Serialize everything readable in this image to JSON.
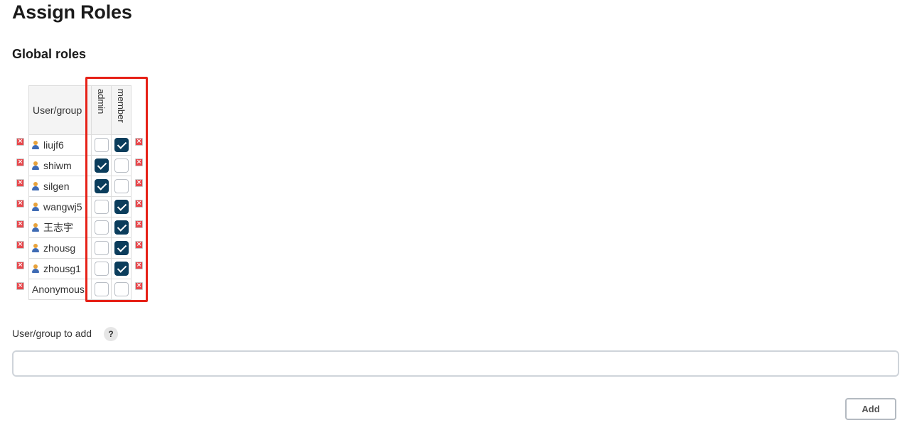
{
  "page": {
    "title": "Assign Roles"
  },
  "section": {
    "title": "Global roles"
  },
  "table": {
    "user_column_header": "User/group",
    "roles": [
      "admin",
      "member"
    ],
    "rows": [
      {
        "name": "liujf6",
        "type": "user",
        "assignments": [
          false,
          true
        ]
      },
      {
        "name": "shiwm",
        "type": "user",
        "assignments": [
          true,
          false
        ]
      },
      {
        "name": "silgen",
        "type": "user",
        "assignments": [
          true,
          false
        ]
      },
      {
        "name": "wangwj5",
        "type": "user",
        "assignments": [
          false,
          true
        ]
      },
      {
        "name": "王志宇",
        "type": "user",
        "assignments": [
          false,
          true
        ]
      },
      {
        "name": "zhousg",
        "type": "user",
        "assignments": [
          false,
          true
        ]
      },
      {
        "name": "zhousg1",
        "type": "user",
        "assignments": [
          false,
          true
        ]
      },
      {
        "name": "Anonymous",
        "type": "group",
        "assignments": [
          false,
          false
        ]
      }
    ]
  },
  "add_form": {
    "label": "User/group to add",
    "help_icon": "?",
    "input_value": "",
    "input_placeholder": "",
    "button_label": "Add"
  },
  "icons": {
    "user": "user-icon",
    "delete": "delete-icon",
    "help": "help-icon"
  },
  "colors": {
    "checked": "#0b3d5c",
    "highlight": "#e62117",
    "delete": "#e8474c"
  }
}
